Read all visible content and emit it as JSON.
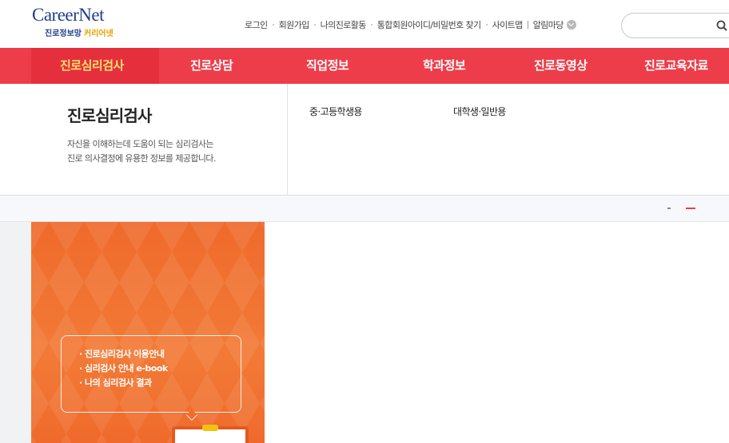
{
  "logo": {
    "main": "CareerNet",
    "sub_a": "진로정보망",
    "sub_b": "커리어넷"
  },
  "util_nav": [
    {
      "label": "로그인"
    },
    {
      "label": "회원가입"
    },
    {
      "label": "나의진로활동"
    },
    {
      "label": "통합회원아이디/비밀번호 찾기"
    },
    {
      "label": "사이트맵"
    },
    {
      "label": "알림마당"
    }
  ],
  "search": {
    "placeholder": "",
    "icon": "search-icon"
  },
  "nav": [
    {
      "label": "진로심리검사"
    },
    {
      "label": "진로상담"
    },
    {
      "label": "직업정보"
    },
    {
      "label": "학과정보"
    },
    {
      "label": "진로동영상"
    },
    {
      "label": "진로교육자료"
    }
  ],
  "mega": {
    "title": "진로심리검사",
    "desc_line1": "자신을 이해하는데 도움이 되는 심리검사는",
    "desc_line2": "진로 의사결정에 유용한 정보를 제공합니다.",
    "links": [
      {
        "label": "중·고등학생용"
      },
      {
        "label": "대학생·일반용"
      }
    ]
  },
  "banner": {
    "links": [
      {
        "label": "· 진로심리검사 이용안내"
      },
      {
        "label": "· 심리검사 안내 e-book"
      },
      {
        "label": "· 나의 심리검사 결과"
      }
    ]
  },
  "colors": {
    "nav_bg": "#ee3d4a",
    "nav_active": "#ffe06b",
    "banner": "#f06a2a",
    "brand_blue": "#1f3f8a"
  }
}
